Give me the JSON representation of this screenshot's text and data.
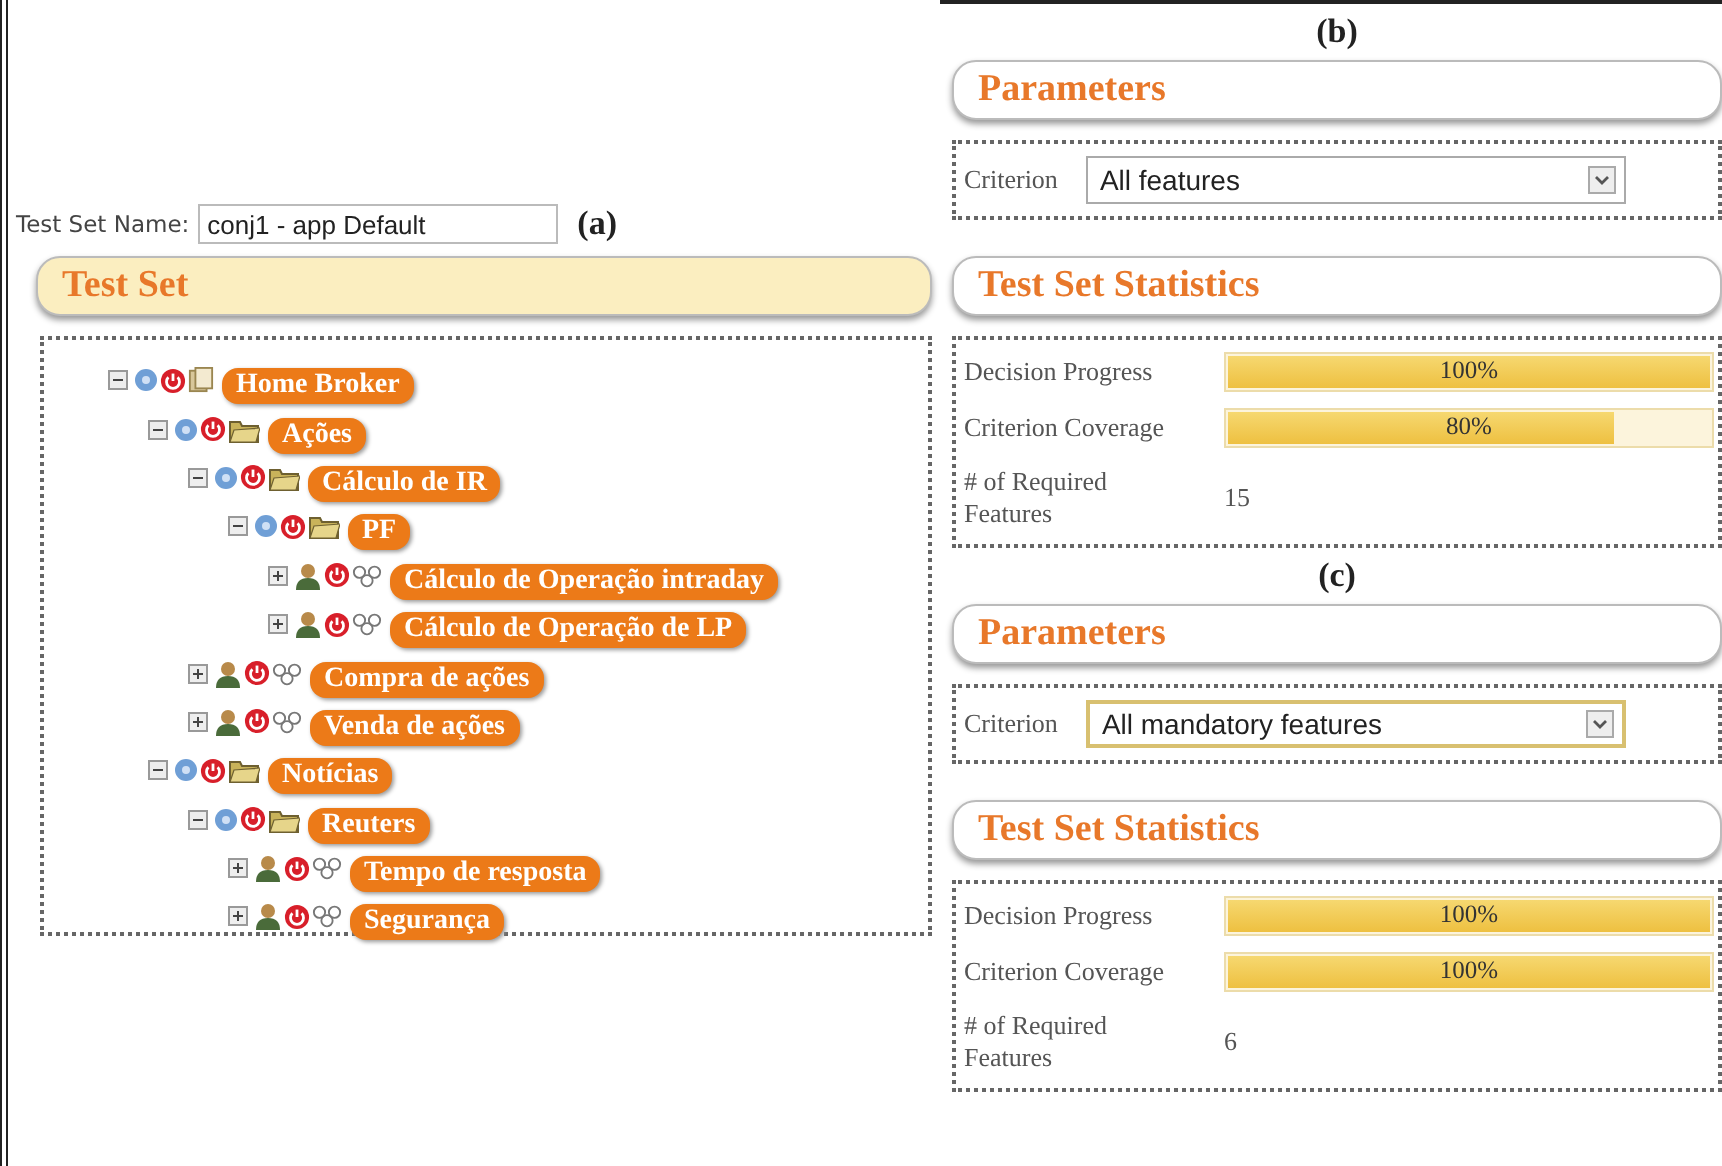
{
  "panel_a": {
    "label": "(a)",
    "name_label": "Test Set Name:",
    "name_value": "conj1 - app Default",
    "title": "Test Set",
    "tree": [
      {
        "label": "Home Broker",
        "kind": "root",
        "expanded": true,
        "children": [
          {
            "label": "Ações",
            "kind": "group",
            "expanded": true,
            "children": [
              {
                "label": "Cálculo de IR",
                "kind": "group",
                "expanded": true,
                "children": [
                  {
                    "label": "PF",
                    "kind": "group",
                    "expanded": true,
                    "children": [
                      {
                        "label": "Cálculo de Operação intraday",
                        "kind": "feature",
                        "expanded": false
                      },
                      {
                        "label": "Cálculo de Operação de LP",
                        "kind": "feature",
                        "expanded": false
                      }
                    ]
                  }
                ]
              },
              {
                "label": "Compra de ações",
                "kind": "feature",
                "expanded": false
              },
              {
                "label": "Venda de ações",
                "kind": "feature",
                "expanded": false
              }
            ]
          },
          {
            "label": "Notícias",
            "kind": "group",
            "expanded": true,
            "children": [
              {
                "label": "Reuters",
                "kind": "group",
                "expanded": true,
                "children": [
                  {
                    "label": "Tempo de resposta",
                    "kind": "feature",
                    "expanded": false
                  },
                  {
                    "label": "Segurança",
                    "kind": "feature",
                    "expanded": false
                  }
                ]
              }
            ]
          }
        ]
      }
    ]
  },
  "panels": [
    {
      "label": "(b)",
      "parameters_title": "Parameters",
      "criterion_label": "Criterion",
      "criterion_value": "All features",
      "criterion_focused": false,
      "statistics_title": "Test Set Statistics",
      "stats": [
        {
          "label": "Decision Progress",
          "level": 1,
          "reading": "100%"
        },
        {
          "label": "Criterion Coverage",
          "level": 0.8,
          "reading": "80%"
        }
      ],
      "required_label": "# of Required Features",
      "required_value": "15"
    },
    {
      "label": "(c)",
      "parameters_title": "Parameters",
      "criterion_label": "Criterion",
      "criterion_value": "All mandatory features",
      "criterion_focused": true,
      "statistics_title": "Test Set Statistics",
      "stats": [
        {
          "label": "Decision Progress",
          "level": 1,
          "reading": "100%"
        },
        {
          "label": "Criterion Coverage",
          "level": 1,
          "reading": "100%"
        }
      ],
      "required_label": "# of Required Features",
      "required_value": "6"
    }
  ]
}
